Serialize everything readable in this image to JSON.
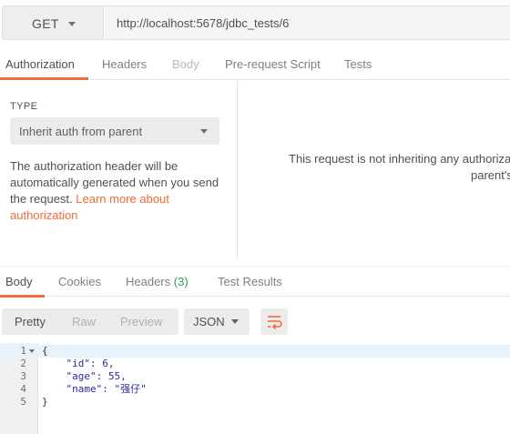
{
  "request": {
    "method": "GET",
    "url": "http://localhost:5678/jdbc_tests/6"
  },
  "request_tabs": [
    "Authorization",
    "Headers",
    "Body",
    "Pre-request Script",
    "Tests"
  ],
  "auth": {
    "type_label": "TYPE",
    "type_value": "Inherit auth from parent",
    "description": "The authorization header will be automatically generated when you send the request.",
    "link_text": "Learn more about authorization",
    "inherit_message_line1": "This request is not inheriting any authorizati",
    "inherit_message_line2": "parent's"
  },
  "response_tabs": {
    "body": "Body",
    "cookies": "Cookies",
    "headers": "Headers",
    "headers_count": "(3)",
    "test_results": "Test Results"
  },
  "toolbar": {
    "pretty": "Pretty",
    "raw": "Raw",
    "preview": "Preview",
    "format": "JSON"
  },
  "code": {
    "line_numbers": [
      "1",
      "2",
      "3",
      "4",
      "5"
    ],
    "lines": [
      "{",
      "    \"id\": 6,",
      "    \"age\": 55,",
      "    \"name\": \"强仔\"",
      "}"
    ]
  },
  "colors": {
    "accent": "#f26b3a",
    "count_green": "#2f9b56"
  },
  "icons": [
    "chevron-down-icon",
    "wrap-lines-icon",
    "fold-arrow-icon"
  ]
}
